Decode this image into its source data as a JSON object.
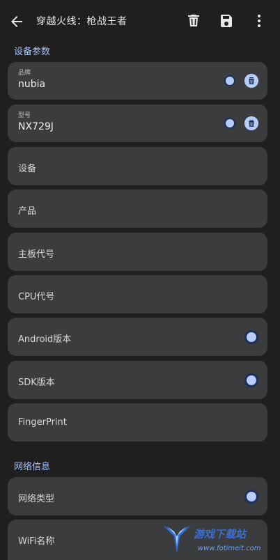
{
  "header": {
    "title": "穿越火线：枪战王者"
  },
  "icons": {
    "back": "arrow-left-icon",
    "delete": "trash-icon",
    "save": "save-icon",
    "more": "more-vert-icon"
  },
  "colors": {
    "background": "#1f1f1f",
    "card": "#3b3c3e",
    "accent": "#a9c5ff",
    "toggle": "#b7cdf9"
  },
  "sections": {
    "device_params": "设备参数",
    "network_info": "网络信息"
  },
  "fields": {
    "brand": {
      "label": "品牌",
      "value": "nubia"
    },
    "model": {
      "label": "型号",
      "value": "NX729J"
    },
    "device": {
      "label": "设备"
    },
    "product": {
      "label": "产品"
    },
    "board": {
      "label": "主板代号"
    },
    "cpu": {
      "label": "CPU代号"
    },
    "android": {
      "label": "Android版本"
    },
    "sdk": {
      "label": "SDK版本"
    },
    "fingerprint": {
      "label": "FingerPrint"
    },
    "network_type": {
      "label": "网络类型"
    },
    "wifi_name": {
      "label": "WiFi名称"
    }
  },
  "watermark": {
    "text": "游戏下载站",
    "url": "www.fotimeit.com"
  }
}
